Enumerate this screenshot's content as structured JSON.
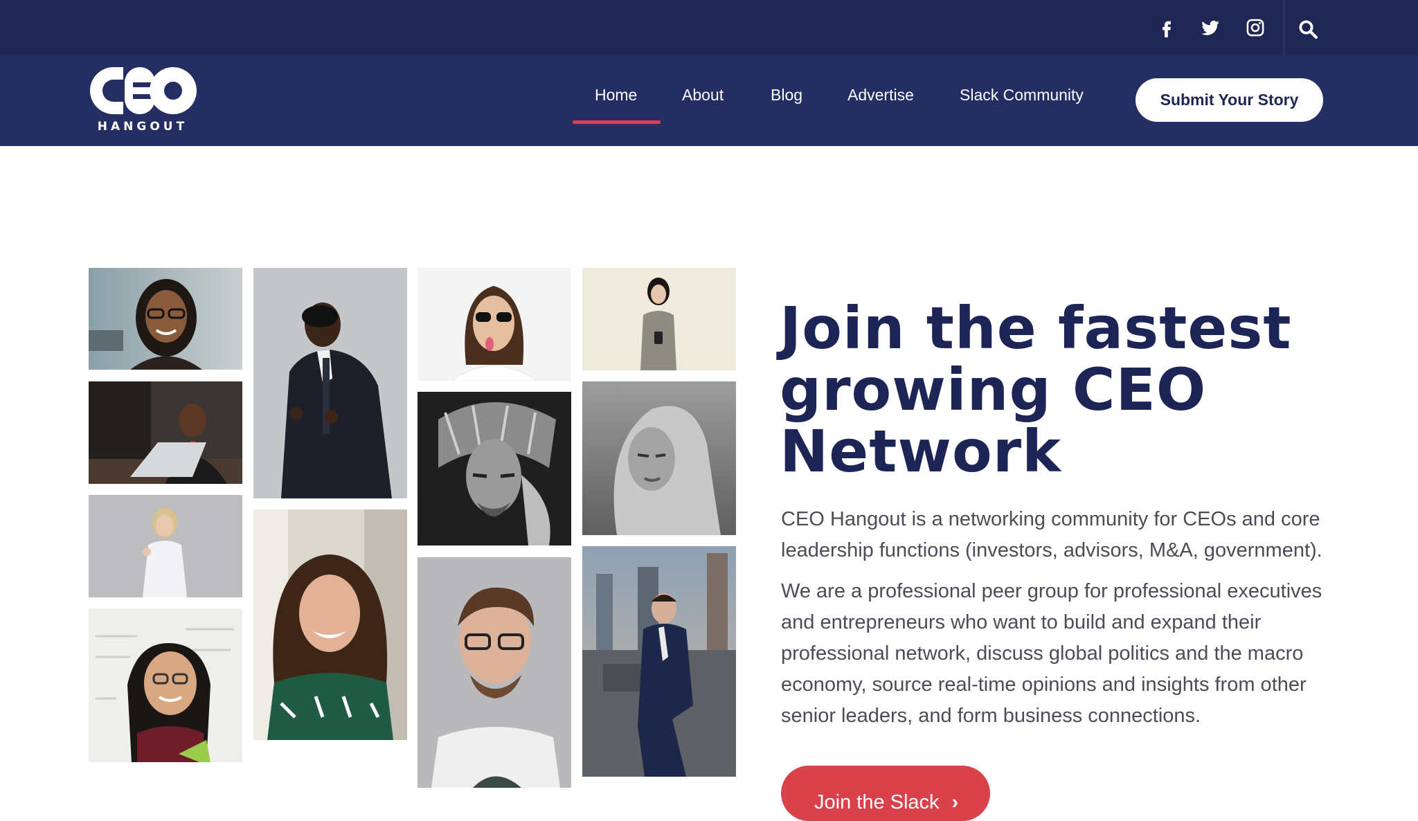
{
  "social": {
    "facebook": "facebook-icon",
    "twitter": "twitter-icon",
    "instagram": "instagram-icon",
    "search": "search-icon"
  },
  "brand": {
    "logo_text": "CEO",
    "logo_sub": "HANGOUT"
  },
  "nav": {
    "items": [
      {
        "label": "Home",
        "active": true
      },
      {
        "label": "About"
      },
      {
        "label": "Blog"
      },
      {
        "label": "Advertise"
      },
      {
        "label": "Slack Community"
      }
    ],
    "submit_label": "Submit Your Story"
  },
  "hero": {
    "title": "Join the fastest growing CEO Network",
    "paragraph1": "CEO Hangout is a networking community for CEOs and core leadership functions (investors, advisors, M&A, government).",
    "paragraph2": "We are a professional peer group for professional executives and entrepreneurs who want to build and expand their professional network, discuss global politics and the macro economy, source real-time opinions and insights from other senior leaders, and form business connections.",
    "cta_label": "Join the Slack",
    "cta_icon": "chevron-right-icon"
  },
  "colors": {
    "topbar": "#1f2654",
    "navbar": "#252e63",
    "accent": "#d9414b",
    "heading": "#1d2557"
  }
}
